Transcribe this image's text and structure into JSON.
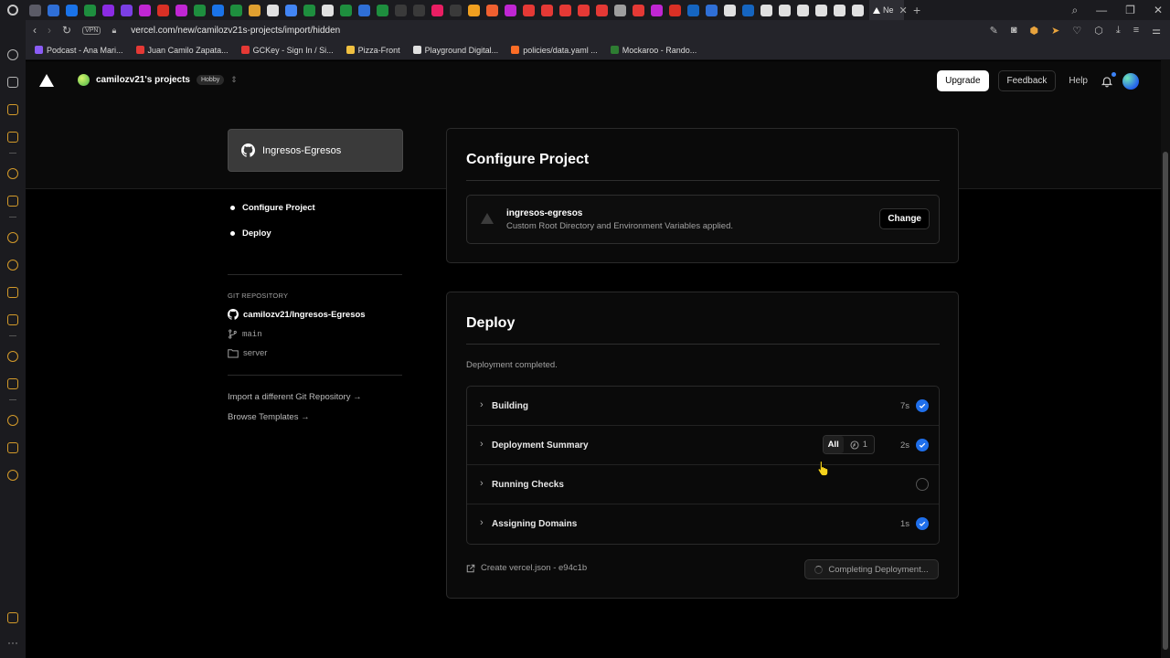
{
  "browser": {
    "url": "vercel.com/new/camilozv21s-projects/import/hidden",
    "vpn_label": "VPN",
    "active_tab_title": "Ne",
    "favicon_colors": [
      "#5b5b66",
      "#2f6fd6",
      "#1a73e8",
      "#1e8e3e",
      "#8a2be2",
      "#7b3fe4",
      "#c026d3",
      "#d93025",
      "#c026d3",
      "#1e8e3e",
      "#1a73e8",
      "#1e8e3e",
      "#e0a030",
      "#e0e0e0",
      "#4285f4",
      "#1e8e3e",
      "#e0e0e0",
      "#1e8e3e",
      "#2f6fd6",
      "#1e8e3e",
      "#3a3a3a",
      "#3a3a3a",
      "#e91e63",
      "#3a3a3a",
      "#f0a020",
      "#f06030",
      "#c026d3",
      "#e53935",
      "#e53935",
      "#e53935",
      "#e53935",
      "#e53935",
      "#9e9e9e",
      "#e53935",
      "#c026d3",
      "#d93025",
      "#1565c0",
      "#2f6fd6",
      "#e0e0e0",
      "#1565c0",
      "#e0e0e0",
      "#e0e0e0",
      "#e0e0e0",
      "#e0e0e0",
      "#e0e0e0",
      "#e0e0e0"
    ],
    "bookmarks": [
      {
        "label": "Podcast - Ana Mari...",
        "color": "#8b5cf6"
      },
      {
        "label": "Juan Camilo Zapata...",
        "color": "#e53935"
      },
      {
        "label": "GCKey - Sign In / Si...",
        "color": "#e53935"
      },
      {
        "label": "Pizza-Front",
        "color": "#f0c040"
      },
      {
        "label": "Playground Digital...",
        "color": "#e0e0e0"
      },
      {
        "label": "policies/data.yaml ...",
        "color": "#fc6d26"
      },
      {
        "label": "Mockaroo - Rando...",
        "color": "#2e7d32"
      }
    ]
  },
  "nav": {
    "team_name": "camilozv21's projects",
    "plan_badge": "Hobby",
    "upgrade_label": "Upgrade",
    "feedback_label": "Feedback",
    "help_label": "Help"
  },
  "left": {
    "repo_name": "Ingresos-Egresos",
    "steps": [
      "Configure Project",
      "Deploy"
    ],
    "git_label": "GIT REPOSITORY",
    "git_repo": "camilozv21/Ingresos-Egresos",
    "branch": "main",
    "directory": "server",
    "import_link": "Import a different Git Repository →",
    "templates_link": "Browse Templates →"
  },
  "configure": {
    "title": "Configure Project",
    "project_name": "ingresos-egresos",
    "project_sub": "Custom Root Directory and Environment Variables applied.",
    "change_label": "Change"
  },
  "deploy": {
    "title": "Deploy",
    "status": "Deployment completed.",
    "rows": [
      {
        "label": "Building",
        "duration": "7s",
        "done": true
      },
      {
        "label": "Deployment Summary",
        "duration": "2s",
        "done": true
      },
      {
        "label": "Running Checks",
        "duration": "",
        "done": false
      },
      {
        "label": "Assigning Domains",
        "duration": "1s",
        "done": true
      }
    ],
    "filter_all": "All",
    "filter_count": "1",
    "commit_link": "Create vercel.json - e94c1b",
    "completing_label": "Completing Deployment..."
  }
}
